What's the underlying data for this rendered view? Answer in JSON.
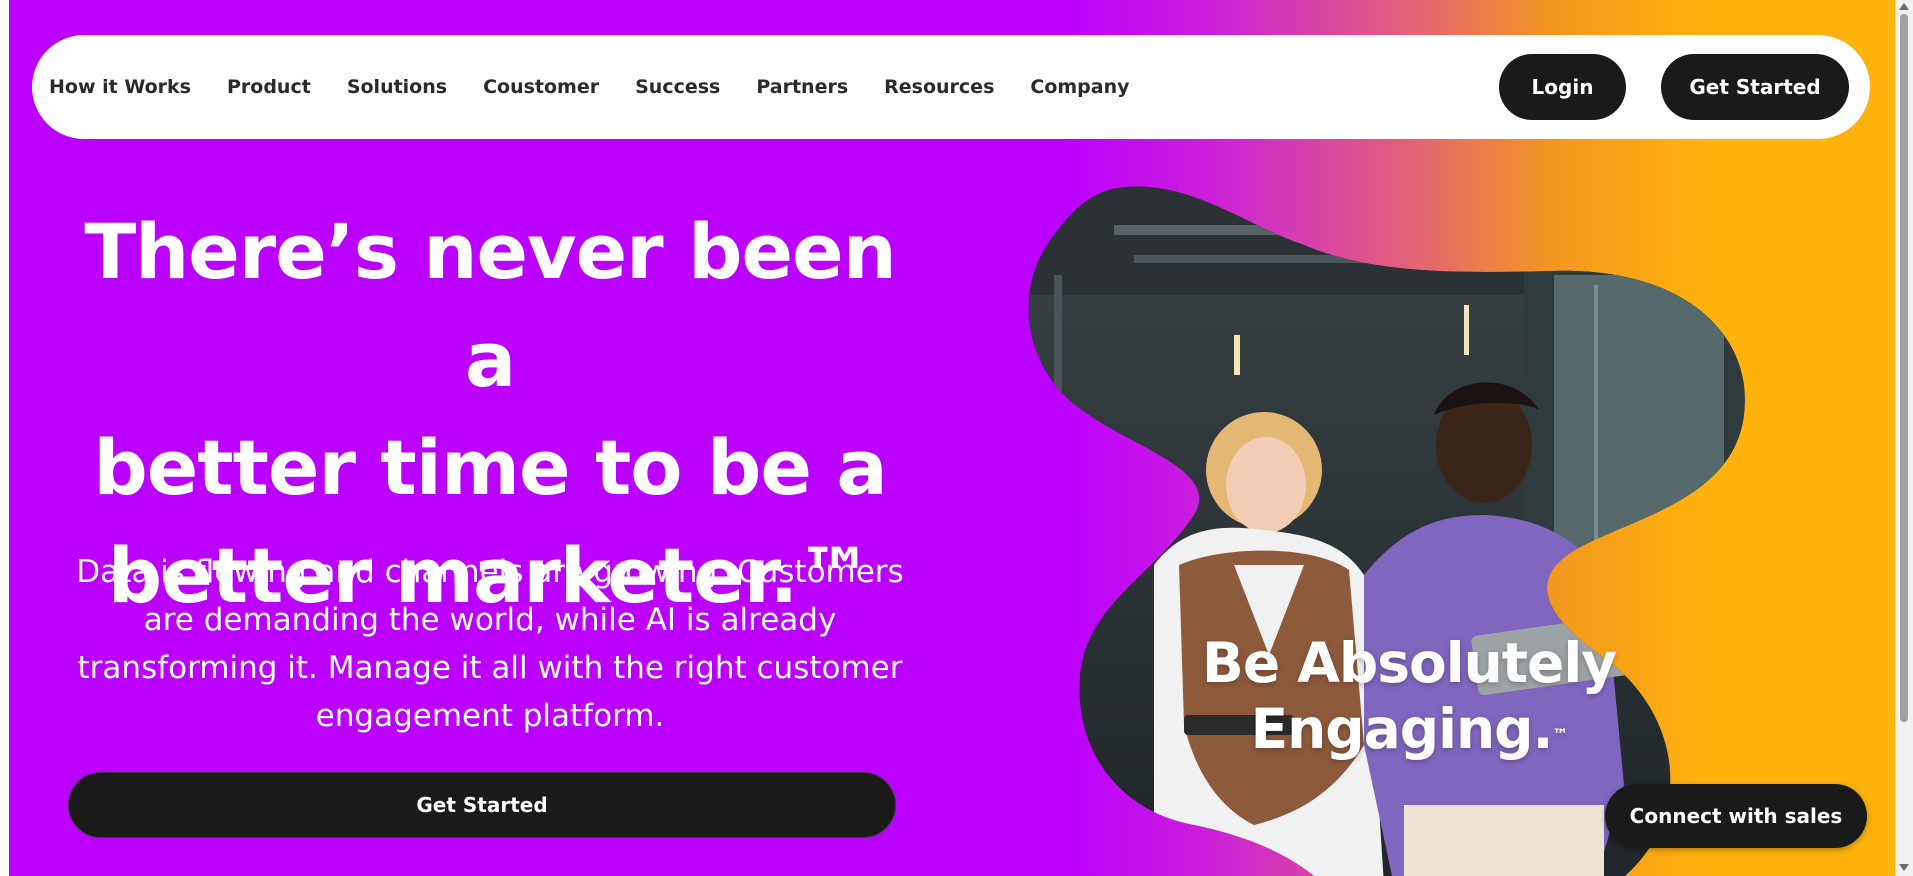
{
  "nav": {
    "links": [
      "How it Works",
      "Product",
      "Solutions",
      "Coustomer",
      "Success",
      "Partners",
      "Resources",
      "Company"
    ],
    "login_label": "Login",
    "get_started_label": "Get Started"
  },
  "hero": {
    "headline_line1": "There’s never been a",
    "headline_line2": "better time to be a",
    "headline_line3": "better marketer.™",
    "subtext": "Data is flowing and channels are growing. Customers are demanding the world, while AI is already transforming it. Manage it all with the right customer engagement platform.",
    "cta_label": "Get Started"
  },
  "image_overlay": {
    "line1": "Be Absolutely",
    "line2": "Engaging.",
    "trademark": "™"
  },
  "sales_button_label": "Connect with sales",
  "colors": {
    "brand_purple": "#bb00ff",
    "brand_orange": "#fdb20c",
    "button_dark": "#1a1a1a"
  },
  "icons": [
    "scroll-up-arrow-icon",
    "scroll-down-arrow-icon"
  ]
}
